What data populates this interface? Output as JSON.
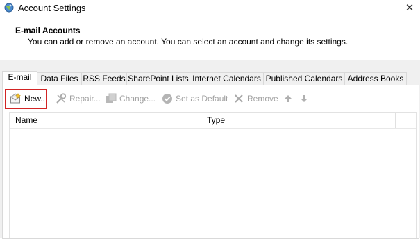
{
  "window": {
    "title": "Account Settings",
    "close_glyph": "✕"
  },
  "header": {
    "title": "E-mail Accounts",
    "description": "You can add or remove an account. You can select an account and change its settings."
  },
  "tabs": [
    {
      "label": "E-mail",
      "active": true
    },
    {
      "label": "Data Files"
    },
    {
      "label": "RSS Feeds"
    },
    {
      "label": "SharePoint Lists"
    },
    {
      "label": "Internet Calendars"
    },
    {
      "label": "Published Calendars"
    },
    {
      "label": "Address Books"
    }
  ],
  "toolbar": {
    "new_label": "New...",
    "repair_label": "Repair...",
    "change_label": "Change...",
    "set_default_label": "Set as Default",
    "remove_label": "Remove"
  },
  "list": {
    "columns": [
      "Name",
      "Type"
    ]
  },
  "colors": {
    "highlight_border": "#d22424",
    "disabled_text": "#a0a0a0",
    "background": "#f0f0f0"
  }
}
